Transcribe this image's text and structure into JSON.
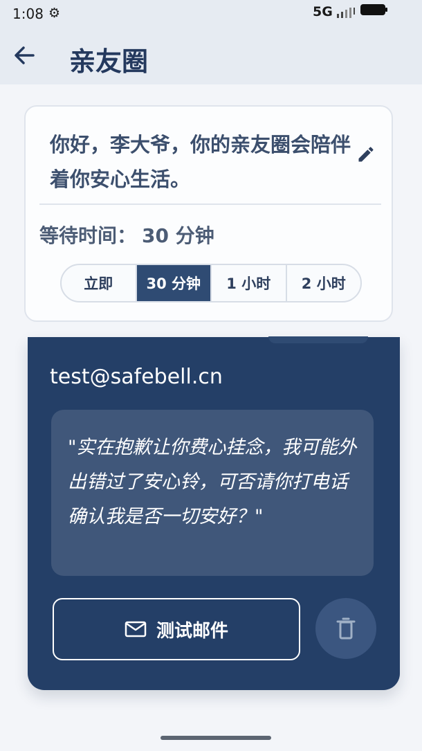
{
  "status_bar": {
    "time": "1:08",
    "network": "5G",
    "icons": [
      "gear-icon",
      "signal-icon",
      "battery-icon"
    ]
  },
  "header": {
    "title": "亲友圈",
    "back_icon": "arrow-left-icon"
  },
  "greeting": {
    "text": "你好，李大爷，你的亲友圈会陪伴着你安心生活。",
    "edit_icon": "pencil-icon"
  },
  "wait_time": {
    "label": "等待时间：",
    "value": "30 分钟",
    "options": [
      "立即",
      "30 分钟",
      "1 小时",
      "2 小时"
    ],
    "selected": "30 分钟"
  },
  "contact": {
    "email": "test@safebell.cn",
    "message": "\"实在抱歉让你费心挂念，我可能外出错过了安心铃，可否请你打电话确认我是否一切安好？\"",
    "test_email_label": "测试邮件",
    "mail_icon": "mail-icon",
    "delete_icon": "trash-icon"
  },
  "colors": {
    "accent": "#243f67",
    "selected_option": "#2f4b73",
    "title": "#24395e",
    "background": "#f3f5f9"
  }
}
